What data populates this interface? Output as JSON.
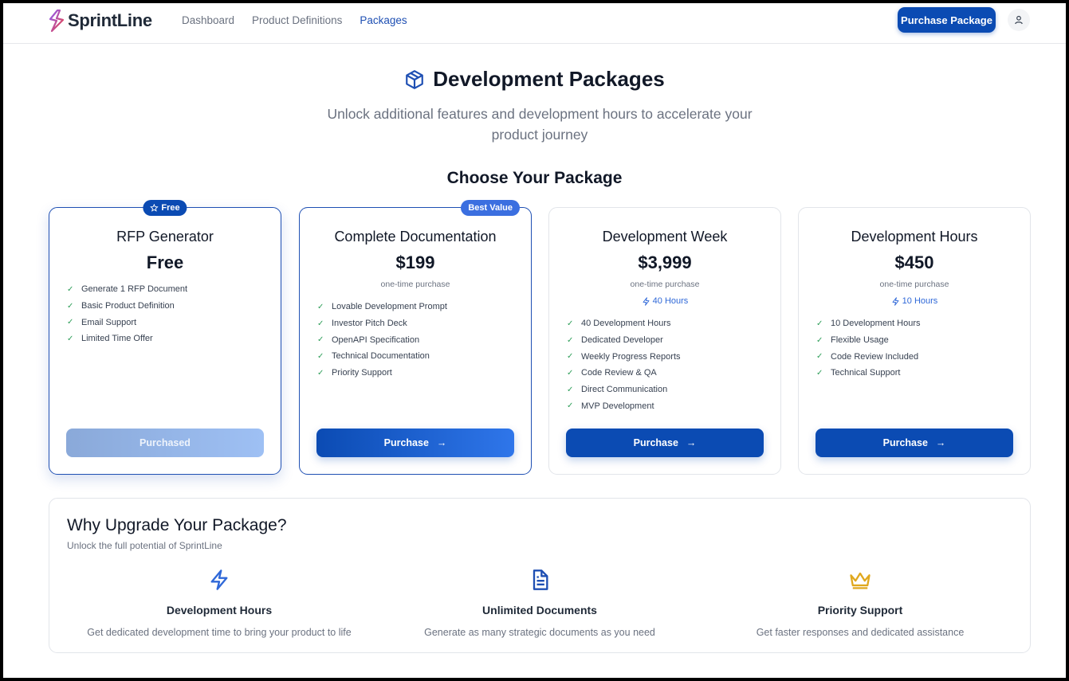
{
  "app": {
    "name": "SprintLine",
    "colors": {
      "primary": "#0b4bb3",
      "accent": "#2f68d8",
      "check": "#2e9e59",
      "crown": "#e0a81e"
    }
  },
  "nav": {
    "items": [
      {
        "label": "Dashboard",
        "active": false
      },
      {
        "label": "Product Definitions",
        "active": false
      },
      {
        "label": "Packages",
        "active": true
      }
    ]
  },
  "header": {
    "purchase_button": "Purchase Package",
    "user_icon": "user-icon"
  },
  "hero": {
    "icon": "package-icon",
    "title": "Development Packages",
    "subtitle": "Unlock additional features and development hours to accelerate your product journey"
  },
  "section_title": "Choose Your Package",
  "packages": [
    {
      "badge": "Free",
      "badge_icon": "star-icon",
      "title": "RFP Generator",
      "price": "Free",
      "note": "",
      "hours": "",
      "features": [
        "Generate 1 RFP Document",
        "Basic Product Definition",
        "Email Support",
        "Limited Time Offer"
      ],
      "button": "Purchased",
      "state": "purchased"
    },
    {
      "badge": "Best Value",
      "badge_icon": "",
      "title": "Complete Documentation",
      "price": "$199",
      "note": "one-time purchase",
      "hours": "",
      "features": [
        "Lovable Development Prompt",
        "Investor Pitch Deck",
        "OpenAPI Specification",
        "Technical Documentation",
        "Priority Support"
      ],
      "button": "Purchase",
      "state": "available"
    },
    {
      "badge": "",
      "badge_icon": "",
      "title": "Development Week",
      "price": "$3,999",
      "note": "one-time purchase",
      "hours": "40 Hours",
      "features": [
        "40 Development Hours",
        "Dedicated Developer",
        "Weekly Progress Reports",
        "Code Review & QA",
        "Direct Communication",
        "MVP Development"
      ],
      "button": "Purchase",
      "state": "available"
    },
    {
      "badge": "",
      "badge_icon": "",
      "title": "Development Hours",
      "price": "$450",
      "note": "one-time purchase",
      "hours": "10 Hours",
      "features": [
        "10 Development Hours",
        "Flexible Usage",
        "Code Review Included",
        "Technical Support"
      ],
      "button": "Purchase",
      "state": "available"
    }
  ],
  "why": {
    "title": "Why Upgrade Your Package?",
    "subtitle": "Unlock the full potential of SprintLine",
    "benefits": [
      {
        "icon": "lightning-icon",
        "title": "Development Hours",
        "desc": "Get dedicated development time to bring your product to life"
      },
      {
        "icon": "document-icon",
        "title": "Unlimited Documents",
        "desc": "Generate as many strategic documents as you need"
      },
      {
        "icon": "crown-icon",
        "title": "Priority Support",
        "desc": "Get faster responses and dedicated assistance"
      }
    ]
  }
}
